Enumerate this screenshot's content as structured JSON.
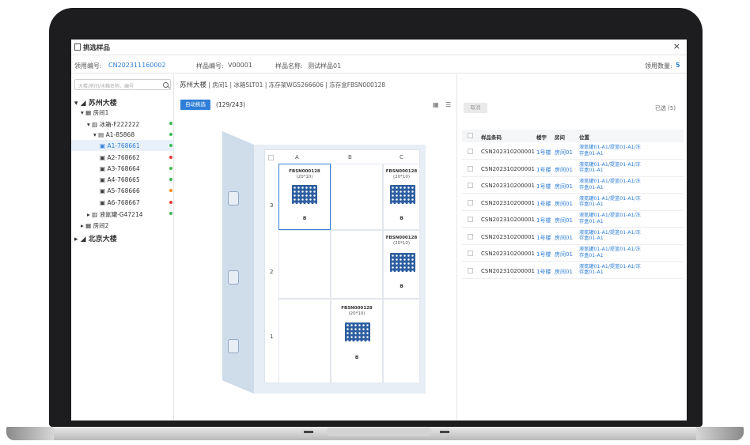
{
  "modal": {
    "title": "挑选样品",
    "close": "×"
  },
  "info": {
    "order_label": "领用编号:",
    "order_value": "CN202311160002",
    "sample_no_label": "样品编号:",
    "sample_no_value": "V00001",
    "sample_name_label": "样品名称:",
    "sample_name_value": "测试样品01",
    "qty_label": "领用数量:",
    "qty_value": "5"
  },
  "tree": {
    "search_placeholder": "大楼/房间/冰箱名称、编号",
    "items": [
      {
        "label": "▾ ◢ 苏州大楼",
        "level": 0
      },
      {
        "label": "▾ ▦ 房间1",
        "level": 1
      },
      {
        "label": "▾ ▥ 冰箱-F222222",
        "level": 2,
        "dot": "#3cba54"
      },
      {
        "label": "▾ ▤ A1-85868",
        "level": 3,
        "dot": "#3cba54"
      },
      {
        "label": "▣ A1-768661",
        "level": 4,
        "dot": "#3cba54",
        "selected": true
      },
      {
        "label": "▣ A2-768662",
        "level": 4,
        "dot": "#e53935"
      },
      {
        "label": "▣ A3-768664",
        "level": 4,
        "dot": "#3cba54"
      },
      {
        "label": "▣ A4-768665",
        "level": 4,
        "dot": "#3cba54"
      },
      {
        "label": "▣ A5-768666",
        "level": 4,
        "dot": "#ff8c1a"
      },
      {
        "label": "▣ A6-768667",
        "level": 4,
        "dot": "#e53935"
      },
      {
        "label": "▸ ▥ 液氮罐-G47214",
        "level": 2,
        "dot": "#3cba54"
      },
      {
        "label": "▸ ▦ 房间2",
        "level": 1
      },
      {
        "label": "▸ ◢ 北京大楼",
        "level": 0
      }
    ]
  },
  "breadcrumb": {
    "building": "苏州大楼",
    "room": "房间1",
    "fridge": "冰箱SLT01",
    "rack": "冻存架WG5266606",
    "box": "冻存盒FBSN000128"
  },
  "toolbar": {
    "auto_label": "自动挑选",
    "count": "(129/243)",
    "view_icons": "▦ ☰"
  },
  "rack": {
    "columns": [
      "A",
      "B",
      "C"
    ],
    "rows": [
      "3",
      "2",
      "1"
    ],
    "boxes": [
      {
        "name": "FBSN000128",
        "dim": "(20*10)",
        "count": "8"
      },
      {
        "name": "FBSN000128",
        "dim": "(20*10)",
        "count": "8"
      },
      {
        "name": "FBSN000128",
        "dim": "(20*10)",
        "count": "8"
      },
      {
        "name": "FBSN000128",
        "dim": "(20*10)",
        "count": "8"
      }
    ]
  },
  "right": {
    "cancel_label": "取消",
    "selected_label": "已选 (5)",
    "headers": {
      "barcode": "样品条码",
      "building": "楼宇",
      "room": "房间",
      "location": "位置"
    },
    "rows": [
      {
        "barcode": "CSN202310200001",
        "building": "1号楼",
        "room": "房间01",
        "location": "液氮罐01-A1/提篮01-A1/冻存盒01-A1"
      },
      {
        "barcode": "CSN202310200001",
        "building": "1号楼",
        "room": "房间01",
        "location": "液氮罐01-A1/提篮01-A1/冻存盒01-A1"
      },
      {
        "barcode": "CSN202310200001",
        "building": "1号楼",
        "room": "房间01",
        "location": "液氮罐01-A1/提篮01-A1/冻存盒01-A1"
      },
      {
        "barcode": "CSN202310200001",
        "building": "1号楼",
        "room": "房间01",
        "location": "液氮罐01-A1/提篮01-A1/冻存盒01-A1"
      },
      {
        "barcode": "CSN202310200001",
        "building": "1号楼",
        "room": "房间01",
        "location": "液氮罐01-A1/提篮01-A1/冻存盒01-A1"
      },
      {
        "barcode": "CSN202310200001",
        "building": "1号楼",
        "room": "房间01",
        "location": "液氮罐01-A1/提篮01-A1/冻存盒01-A1"
      },
      {
        "barcode": "CSN202310200001",
        "building": "1号楼",
        "room": "房间01",
        "location": "液氮罐01-A1/提篮01-A1/冻存盒01-A1"
      },
      {
        "barcode": "CSN202310200001",
        "building": "1号楼",
        "room": "房间01",
        "location": "液氮罐01-A1/提篮01-A1/冻存盒01-A1"
      }
    ]
  },
  "colors": {
    "accent": "#2f7fd8",
    "bezel": "#1d1d1f"
  }
}
